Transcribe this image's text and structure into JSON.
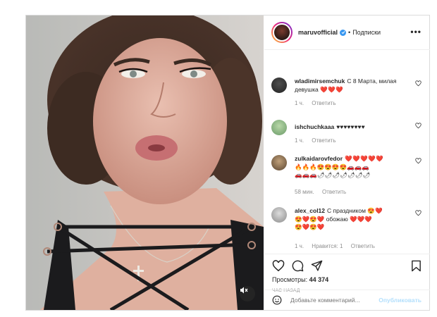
{
  "post": {
    "username": "maruvofficial",
    "separator": "•",
    "follow_label": "Подписки",
    "more_label": "•••"
  },
  "comments": [
    {
      "user": "wladimirsemchuk",
      "text": "С 8 Марта, милая девушка",
      "hearts": "❤️❤️❤️",
      "time": "1 ч.",
      "reply": "Ответить"
    },
    {
      "user": "ishchuchkaaa",
      "text": "",
      "hearts": "♥♥♥♥♥♥♥♥",
      "time": "1 ч.",
      "reply": "Ответить"
    },
    {
      "user": "zulkaidarovfedor",
      "text": "",
      "hearts": "❤️❤️❤️❤️❤️",
      "emoji1": "🔥🔥🔥😍😍😍😍🚗🚗🚗",
      "emoji2": "🚗🚗🚗🌶🌶🌶🌶🌶🌶🌶",
      "time": "58 мин.",
      "reply": "Ответить"
    },
    {
      "user": "alex_col12",
      "text": "С праздником",
      "hearts": "😍❤️",
      "line2": "😍❤️😍❤️ обожаю ❤️❤️❤️",
      "line3": "😍❤️😍❤️",
      "time": "1 ч.",
      "likes": "Нравится: 1",
      "reply": "Ответить"
    }
  ],
  "stats": {
    "views_label": "Просмотры:",
    "views_value": "44 374",
    "time_ago": "ЧАС НАЗАД"
  },
  "composer": {
    "placeholder": "Добавьте комментарий...",
    "publish_label": "Опубликовать",
    "emoji_icon": "smiley-icon"
  },
  "colors": {
    "accent": "#3897f0",
    "heart": "#e0245e",
    "muted": "#8e8e8e",
    "border": "#dbdbdb"
  }
}
